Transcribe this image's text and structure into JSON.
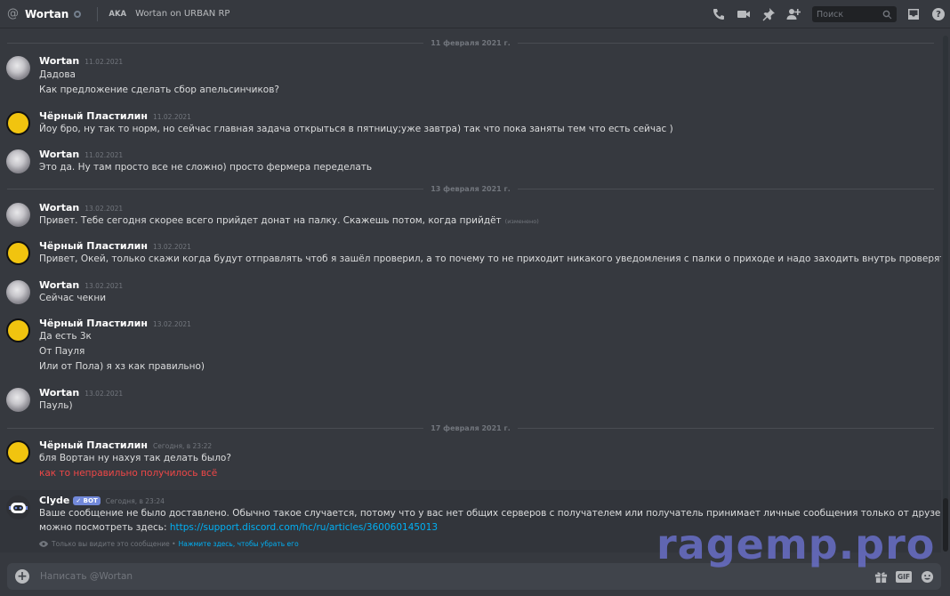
{
  "header": {
    "at_symbol": "@",
    "title": "Wortan",
    "aka_label": "AKA",
    "nickname": "Wortan on URBAN RP",
    "search_placeholder": "Поиск",
    "help_label": "?"
  },
  "dividers": [
    "11 февраля 2021 г.",
    "13 февраля 2021 г.",
    "17 февраля 2021 г."
  ],
  "messages": [
    {
      "author": "Wortan",
      "time": "11.02.2021",
      "lines": [
        "Дадова",
        "Как предложение сделать сбор апельсинчиков?"
      ]
    },
    {
      "author": "Чёрный Пластилин",
      "time": "11.02.2021",
      "lines": [
        "Йоу бро, ну так то норм, но сейчас главная задача открыться в пятницу;уже завтра) так что пока заняты тем что есть сейчас )"
      ]
    },
    {
      "author": "Wortan",
      "time": "11.02.2021",
      "lines": [
        "Это да. Ну там просто все не сложно) просто фермера переделать"
      ]
    },
    {
      "author": "Wortan",
      "time": "13.02.2021",
      "lines": [
        "Привет. Тебе сегодня скорее всего прийдет донат на палку. Скажешь потом, когда прийдёт"
      ],
      "edited": "(изменено)"
    },
    {
      "author": "Чёрный Пластилин",
      "time": "13.02.2021",
      "lines": [
        "Привет, Окей, только скажи когда будут отправлять чтоб я зашёл проверил, а то почему то не приходит никакого уведомления с палки о приходе и надо заходить внутрь проверять"
      ]
    },
    {
      "author": "Wortan",
      "time": "13.02.2021",
      "lines": [
        "Сейчас чекни"
      ]
    },
    {
      "author": "Чёрный Пластилин",
      "time": "13.02.2021",
      "lines": [
        "Да есть 3к",
        "От Пауля",
        "Или от Пола) я хз как правильно)"
      ]
    },
    {
      "author": "Wortan",
      "time": "13.02.2021",
      "lines": [
        "Пауль)"
      ]
    },
    {
      "author": "Чёрный Пластилин",
      "time": "Сегодня, в 23:22",
      "lines": [
        "бля Вортан ну нахуя так делать было?"
      ],
      "failed_line": "как то неправильно получилось всё"
    },
    {
      "author": "Clyde",
      "bot_tag": "✓ BOT",
      "time": "Сегодня, в 23:24",
      "lines": [
        "Ваше сообщение не было доставлено. Обычно такое случается, потому что у вас нет общих серверов с получателем или получатель принимает личные сообщения только от друзей. Полный перечень причин",
        "можно посмотреть здесь:"
      ],
      "link": "https://support.discord.com/hc/ru/articles/360060145013",
      "ephemeral_note": "Только вы видите это сообщение •",
      "dismiss_label": "Нажмите здесь, чтобы убрать его"
    }
  ],
  "composer": {
    "placeholder": "Написать @Wortan",
    "gif_label": "GIF"
  },
  "watermark": "ragemp.pro",
  "colors": {
    "background": "#36393f",
    "accent": "#7289da",
    "link": "#00b0f4",
    "error": "#f04747"
  }
}
